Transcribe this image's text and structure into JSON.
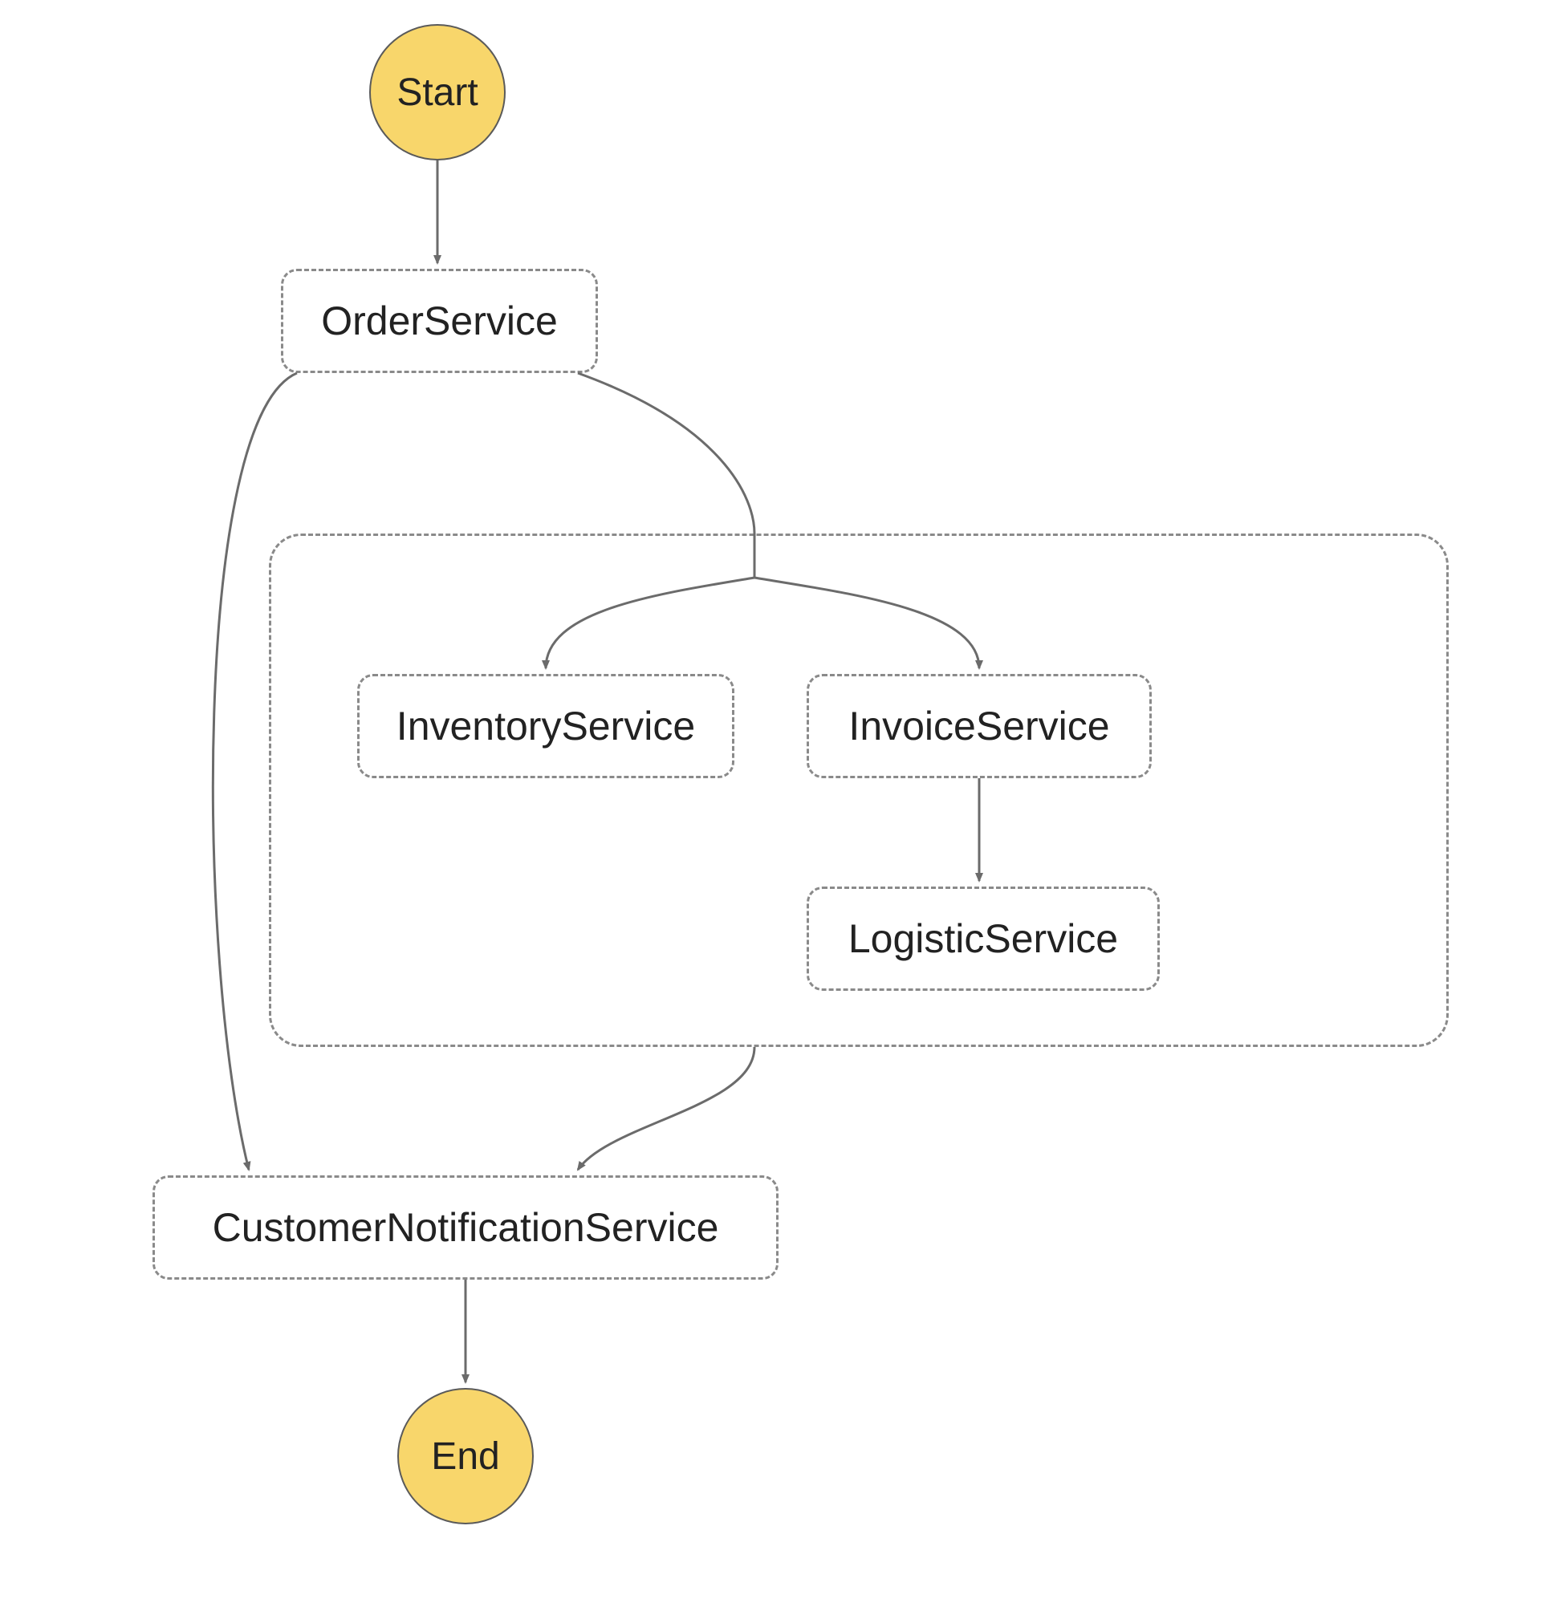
{
  "nodes": {
    "start": {
      "label": "Start"
    },
    "end": {
      "label": "End"
    },
    "order": {
      "label": "OrderService"
    },
    "inventory": {
      "label": "InventoryService"
    },
    "invoice": {
      "label": "InvoiceService"
    },
    "logistic": {
      "label": "LogisticService"
    },
    "notification": {
      "label": "CustomerNotificationService"
    }
  },
  "edges": [
    {
      "from": "start",
      "to": "order"
    },
    {
      "from": "order",
      "to": "inventory"
    },
    {
      "from": "order",
      "to": "invoice"
    },
    {
      "from": "order",
      "to": "notification"
    },
    {
      "from": "invoice",
      "to": "logistic"
    },
    {
      "from": "group",
      "to": "notification"
    },
    {
      "from": "notification",
      "to": "end"
    }
  ],
  "colors": {
    "terminal_fill": "#f8d66b",
    "border": "#5a5a5a",
    "dash": "#8a8a8a",
    "arrow": "#6b6b6b"
  }
}
